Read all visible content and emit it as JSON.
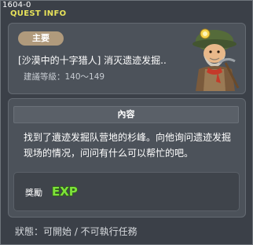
{
  "window": {
    "quest_id": "1604-0",
    "title": "QUEST INFO"
  },
  "quest": {
    "tag": "主要",
    "name": "[沙漠中的十字猎人] 消灭遗迹发掘..",
    "level": "建議等級：140～149"
  },
  "content": {
    "header": "內容",
    "description_line1": "找到了遺迹发掘队营地的杉峰。向他询问遗迹发掘",
    "description_line2": "现场的情况，问问有什么可以帮忙的吧。"
  },
  "reward": {
    "label": "獎勵",
    "exp_text": "EXP"
  },
  "status": {
    "text": "狀態：可開始 / 不可執行任務"
  },
  "colors": {
    "title": "#e8e35a",
    "tag_bg": "#b09a7c",
    "exp": "#7ee23a"
  }
}
